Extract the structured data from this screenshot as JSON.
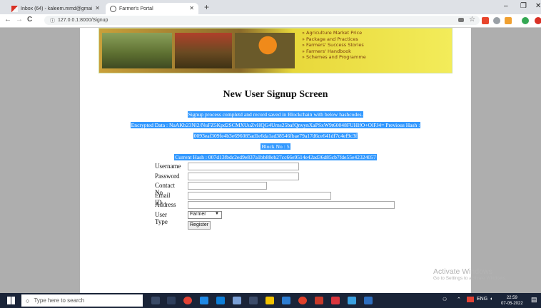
{
  "browser": {
    "tabs": [
      {
        "title": "Inbox (64) - kaleem.mmd@gmai",
        "icon": "gmail-icon",
        "active": false
      },
      {
        "title": "Farmer's Portal",
        "icon": "globe-icon",
        "active": true
      }
    ],
    "new_tab": "+",
    "window": {
      "minimize": "–",
      "maximize": "❐",
      "close": "✕"
    },
    "url": "127.0.0.1:8000/Signup",
    "nav": {
      "back": "←",
      "forward": "→",
      "reload": "C",
      "info": "ⓘ"
    }
  },
  "banner": {
    "links": [
      "Agriculture Market Price",
      "Package and Practices",
      "Farmers' Success Stories",
      "Farmers' Handbook",
      "Schemes and Programme"
    ]
  },
  "page": {
    "title": "New User Signup Screen",
    "messages": [
      "Signup process completd and record saved in Blockchain with below hashcodes.",
      "Encrypted Data : NaAKb23Nl2/NuFZ5Kpd2SCMXUuZvHQG4Urns25bafQnvynXaPSxW9t60048FUHlfO+OlFJ4= Previous Hash :",
      "0093eaf309fe4b3e696085ad1e6da1ad38546fbae79a17d6ce641df7c4ef9c3f",
      "Block No : 5",
      "Current Hash : 007d13fbdc2ed9e837a1bb88eb27cc66e9514e42ad36d85cb7fde55e42324057"
    ],
    "form": {
      "fields": [
        {
          "label": "Username",
          "value": ""
        },
        {
          "label": "Password",
          "value": ""
        },
        {
          "label": "Contact No",
          "value": ""
        },
        {
          "label": "Email ID",
          "value": ""
        },
        {
          "label": "Address",
          "value": ""
        }
      ],
      "user_type_label": "User Type",
      "user_type_value": "Farmer",
      "submit_label": "Register"
    }
  },
  "watermark": {
    "title": "Activate Windows",
    "subtitle": "Go to Settings to activate Windows."
  },
  "taskbar": {
    "search_placeholder": "Type here to search",
    "time": "22:59",
    "date": "07-05-2022",
    "lang": "ENG"
  },
  "colors": {
    "selection": "#3399ff",
    "taskbar": "#1a2438",
    "banner_text": "#7a3a10"
  }
}
